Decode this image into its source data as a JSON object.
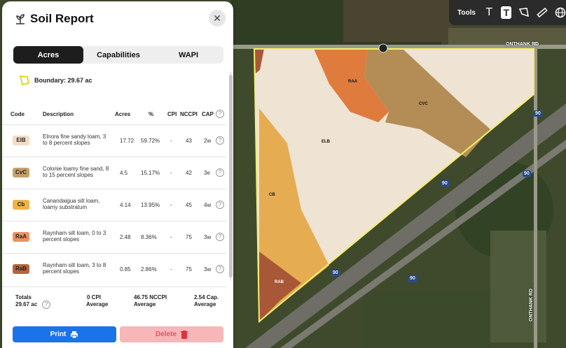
{
  "panel": {
    "title": "Soil Report",
    "tabs": [
      "Acres",
      "Capabilities",
      "WAPI"
    ],
    "active_tab": 0,
    "boundary_label": "Boundary: 29.67 ac"
  },
  "table": {
    "headers": {
      "code": "Code",
      "description": "Description",
      "acres": "Acres",
      "percent": "%",
      "cpi": "CPI",
      "nccpi": "NCCPI",
      "cap": "CAP"
    },
    "rows": [
      {
        "code": "ElB",
        "color": "#f5dcc4",
        "description": "Elnora fine sandy loam, 3 to 8 percent slopes",
        "acres": "17.72",
        "percent": "59.72%",
        "cpi": "-",
        "nccpi": "43",
        "cap": "2w"
      },
      {
        "code": "CvC",
        "color": "#c6a06a",
        "description": "Colonie loamy fine sand, 8 to 15 percent slopes",
        "acres": "4.5",
        "percent": "15.17%",
        "cpi": "-",
        "nccpi": "42",
        "cap": "3e"
      },
      {
        "code": "Cb",
        "color": "#f0b347",
        "description": "Canandaigua silt loam, loamy substratum",
        "acres": "4.14",
        "percent": "13.95%",
        "cpi": "-",
        "nccpi": "45",
        "cap": "4w"
      },
      {
        "code": "RaA",
        "color": "#ed9161",
        "description": "Raynham silt loam, 0 to 3 percent slopes",
        "acres": "2.48",
        "percent": "8.36%",
        "cpi": "-",
        "nccpi": "75",
        "cap": "3w"
      },
      {
        "code": "RaB",
        "color": "#b8643f",
        "description": "Raynham silt loam, 3 to 8 percent slopes",
        "acres": "0.85",
        "percent": "2.86%",
        "cpi": "-",
        "nccpi": "75",
        "cap": "3w"
      }
    ],
    "totals": {
      "label": "Totals",
      "acres": "29.67 ac",
      "cpi_value": "0 CPI",
      "cpi_sub": "Average",
      "nccpi_value": "46.75 NCCPI",
      "nccpi_sub": "Average",
      "cap_value": "2.54 Cap.",
      "cap_sub": "Average"
    }
  },
  "buttons": {
    "print": "Print",
    "delete": "Delete"
  },
  "toolbar": {
    "label": "Tools"
  },
  "map": {
    "soil_labels": [
      "RAA",
      "CVC",
      "ELB",
      "CB",
      "RAB"
    ],
    "road_labels": [
      "ONTHANK RD",
      "ONTHANK RD"
    ],
    "highway_shields": [
      "90",
      "90",
      "90",
      "90",
      "90"
    ]
  },
  "colors": {
    "accent": "#1a73e8",
    "boundary": "#f2ef6a",
    "delete_bg": "#f7b6b9"
  }
}
